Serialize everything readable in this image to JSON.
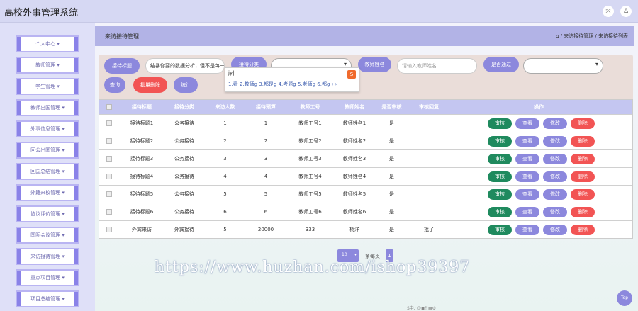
{
  "app": {
    "title": "高校外事管理系统"
  },
  "header": {
    "icons": [
      "fullscreen-icon",
      "user-icon"
    ],
    "fullscreen_glyph": "⤧",
    "user_glyph": "♙"
  },
  "sidebar": {
    "items": [
      {
        "label": "个人中心"
      },
      {
        "label": "教师管理"
      },
      {
        "label": "学生管理"
      },
      {
        "label": "教师出国管理"
      },
      {
        "label": "外事信息管理"
      },
      {
        "label": "回公出国管理"
      },
      {
        "label": "回国总结管理"
      },
      {
        "label": "外籍来校管理"
      },
      {
        "label": "协议评价管理"
      },
      {
        "label": "国际会议管理"
      },
      {
        "label": "来访接待管理"
      },
      {
        "label": "重点项目管理"
      },
      {
        "label": "项目总结管理"
      }
    ],
    "chevron": "▾"
  },
  "breadcrumb": {
    "page_title": "来访接待管理",
    "path": "⌂ / 来访接待管理 / 来访接待列表"
  },
  "filter": {
    "btn_title": "接待标题",
    "title_value": "结暴你要的数据分析，但不是每一个",
    "btn_category": "接待分类",
    "btn_teacher_name": "教师姓名",
    "teacher_name_placeholder": "请输入教师姓名",
    "btn_approved": "是否通过",
    "btn_query": "查询",
    "btn_batch_delete": "批量删除",
    "btn_stats": "统计"
  },
  "ime": {
    "input": "jy|",
    "candidates": "1.看  2.教师g  3.都是g  4.考题g  5.老师g  6.都g  ‹  ›",
    "logo": "S"
  },
  "table": {
    "headers": [
      "接待标题",
      "接待分类",
      "来访人数",
      "接待预算",
      "教师工号",
      "教师姓名",
      "是否审核",
      "审核回复",
      "操作"
    ],
    "rows": [
      [
        "接待标题1",
        "公务接待",
        "1",
        "1",
        "教师工号1",
        "教师姓名1",
        "是",
        ""
      ],
      [
        "接待标题2",
        "公务接待",
        "2",
        "2",
        "教师工号2",
        "教师姓名2",
        "是",
        ""
      ],
      [
        "接待标题3",
        "公务接待",
        "3",
        "3",
        "教师工号3",
        "教师姓名3",
        "是",
        ""
      ],
      [
        "接待标题4",
        "公务接待",
        "4",
        "4",
        "教师工号4",
        "教师姓名4",
        "是",
        ""
      ],
      [
        "接待标题5",
        "公务接待",
        "5",
        "5",
        "教师工号5",
        "教师姓名5",
        "是",
        ""
      ],
      [
        "接待标题6",
        "公务接待",
        "6",
        "6",
        "教师工号6",
        "教师姓名6",
        "是",
        ""
      ],
      [
        "外宾来访",
        "外宾接待",
        "5",
        "20000",
        "333",
        "杨洋",
        "是",
        "批了"
      ]
    ],
    "actions": {
      "audit": "审核",
      "view": "查看",
      "edit": "修改",
      "delete": "删除"
    }
  },
  "pager": {
    "page_size": "10",
    "per_page_label": "条每页",
    "page": "1"
  },
  "watermark": "https://www.huzhan.com/ishop39397",
  "back_to_top": "Top",
  "tray": "S中♪☺▣⠿▦⚙",
  "colors": {
    "accent": "#8c88dd",
    "danger": "#f25454",
    "success": "#1f8a5e"
  }
}
